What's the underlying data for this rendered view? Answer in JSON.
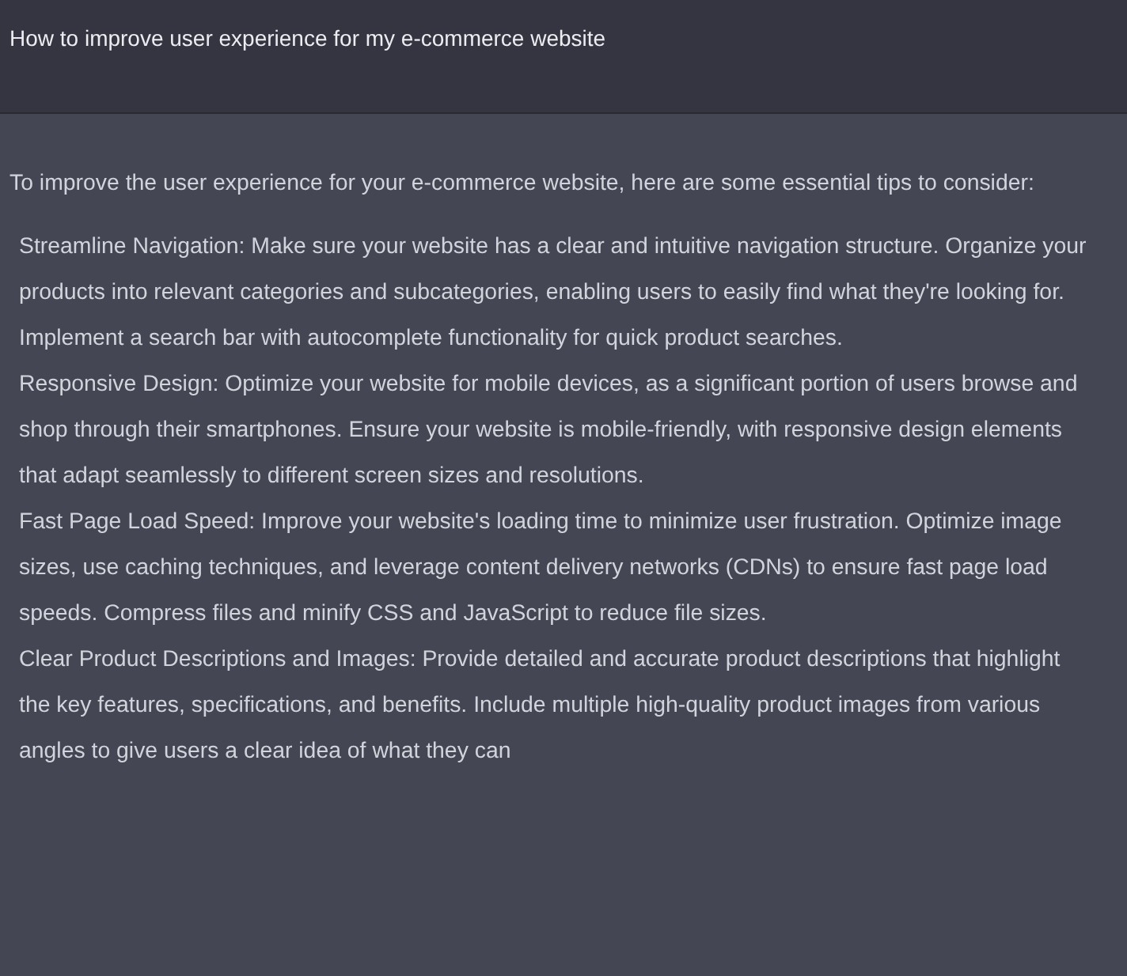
{
  "question": "How to improve user experience for my e-commerce website",
  "intro": "To improve the user experience for your e-commerce website, here are some essential tips to consider:",
  "items": [
    "Streamline Navigation: Make sure your website has a clear and intuitive navigation structure. Organize your products into relevant categories and subcategories, enabling users to easily find what they're looking for. Implement a search bar with autocomplete functionality for quick product searches.",
    "Responsive Design: Optimize your website for mobile devices, as a significant portion of users browse and shop through their smartphones. Ensure your website is mobile-friendly, with responsive design elements that adapt seamlessly to different screen sizes and resolutions.",
    "Fast Page Load Speed: Improve your website's loading time to minimize user frustration. Optimize image sizes, use caching techniques, and leverage content delivery networks (CDNs) to ensure fast page load speeds. Compress files and minify CSS and JavaScript to reduce file sizes.",
    "Clear Product Descriptions and Images: Provide detailed and accurate product descriptions that highlight the key features, specifications, and benefits. Include multiple high-quality product images from various angles to give users a clear idea of what they can"
  ]
}
